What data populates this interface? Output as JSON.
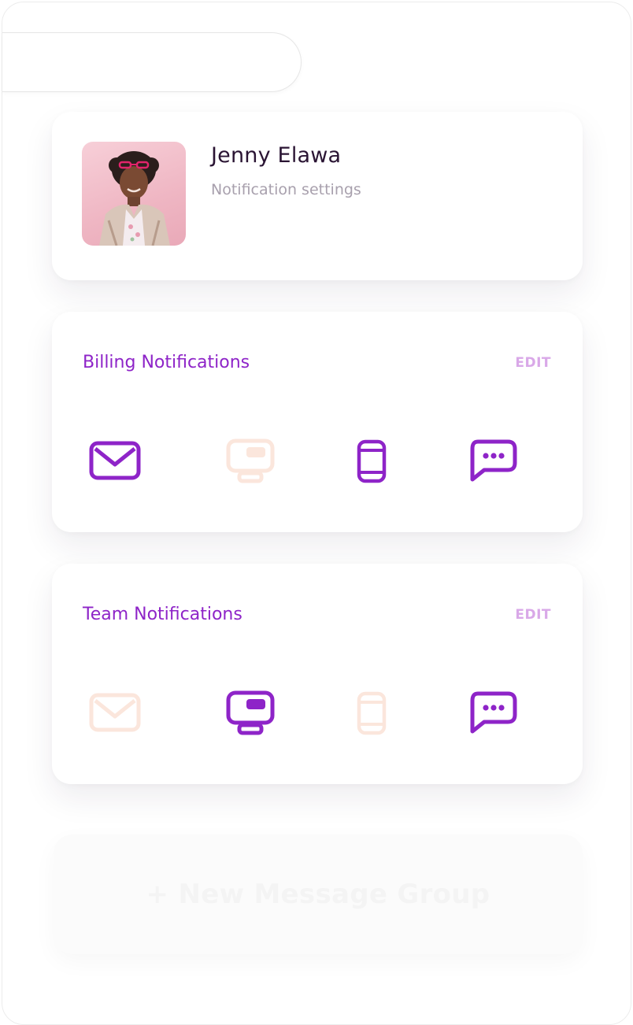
{
  "profile": {
    "name": "Jenny Elawa",
    "subtitle": "Notification settings"
  },
  "colors": {
    "accent": "#8e24c8",
    "inactive": "#fbe6dc",
    "edit": "#d9a8e8",
    "name": "#2a1433",
    "subtitle": "#a8a0ad"
  },
  "billing": {
    "title": "Billing Notifications",
    "edit_label": "EDIT",
    "channels": [
      {
        "icon": "mail-icon",
        "enabled": true
      },
      {
        "icon": "desktop-icon",
        "enabled": false
      },
      {
        "icon": "mobile-icon",
        "enabled": true
      },
      {
        "icon": "chat-icon",
        "enabled": true
      }
    ]
  },
  "team": {
    "title": "Team Notifications",
    "edit_label": "EDIT",
    "channels": [
      {
        "icon": "mail-icon",
        "enabled": false
      },
      {
        "icon": "desktop-icon",
        "enabled": true
      },
      {
        "icon": "mobile-icon",
        "enabled": false
      },
      {
        "icon": "chat-icon",
        "enabled": true
      }
    ]
  },
  "new_group": {
    "label": "+ New Message Group"
  }
}
